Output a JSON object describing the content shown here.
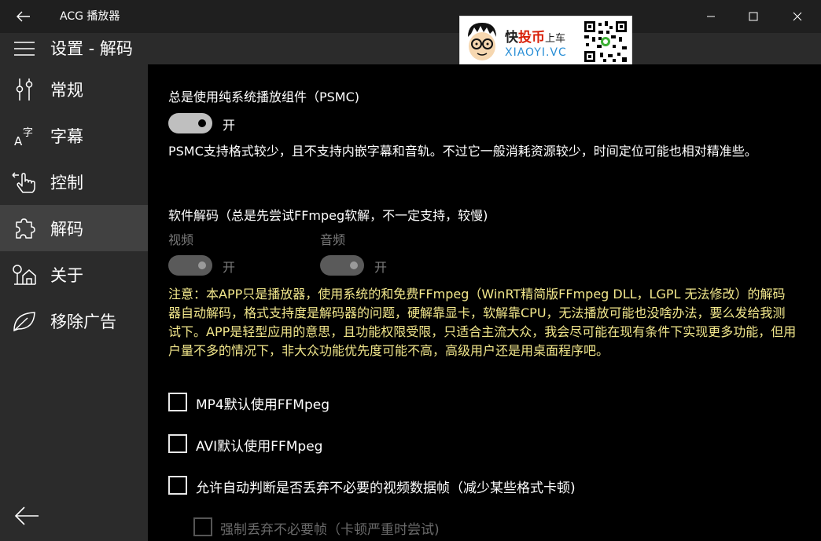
{
  "window": {
    "title": "ACG 播放器"
  },
  "header": {
    "page_title": "设置 - 解码"
  },
  "watermark": {
    "text_prefix": "快",
    "text_brand": "投币",
    "text_suffix": "上车",
    "url": "XIAOYI.VC"
  },
  "sidebar": {
    "items": [
      {
        "label": "常规",
        "icon": "settings-sliders-icon"
      },
      {
        "label": "字幕",
        "icon": "subtitle-icon"
      },
      {
        "label": "控制",
        "icon": "touch-hand-icon"
      },
      {
        "label": "解码",
        "icon": "puzzle-icon"
      },
      {
        "label": "关于",
        "icon": "home-info-icon"
      },
      {
        "label": "移除广告",
        "icon": "leaf-icon"
      }
    ],
    "active_index": 3
  },
  "psmc": {
    "heading": "总是使用纯系统播放组件（PSMC)",
    "toggle_label": "开",
    "description": "PSMC支持格式较少，且不支持内嵌字幕和音轨。不过它一般消耗资源较少，时间定位可能也相对精准些。"
  },
  "software_decode": {
    "heading": "软件解码（总是先尝试FFmpeg软解，不一定支持，较慢)",
    "video_label": "视频",
    "audio_label": "音频",
    "video_toggle_label": "开",
    "audio_toggle_label": "开"
  },
  "notice": {
    "text": "注意：本APP只是播放器，使用系统的和免费FFmpeg（WinRT精简版FFmpeg DLL，LGPL 无法修改）的解码器自动解码，格式支持度是解码器的问题，硬解靠显卡，软解靠CPU，无法播放可能也没啥办法，要么发给我测试下。APP是轻型应用的意思，且功能权限受限，只适合主流大众，我会尽可能在现有条件下实现更多功能，但用户量不多的情况下，非大众功能优先度可能不高，高级用户还是用桌面程序吧。"
  },
  "options": {
    "mp4_ffmpeg": "MP4默认使用FFMpeg",
    "avi_ffmpeg": "AVI默认使用FFMpeg",
    "auto_drop_frames": "允许自动判断是否丢弃不必要的视频数据帧（减少某些格式卡顿)",
    "force_drop_frames": "强制丢弃不必要帧（卡顿严重时尝试)"
  },
  "colors": {
    "accent_notice": "#f3e88c",
    "sidebar_bg": "#2b2b2b",
    "active_item_bg": "#414141",
    "content_bg": "#000000"
  }
}
